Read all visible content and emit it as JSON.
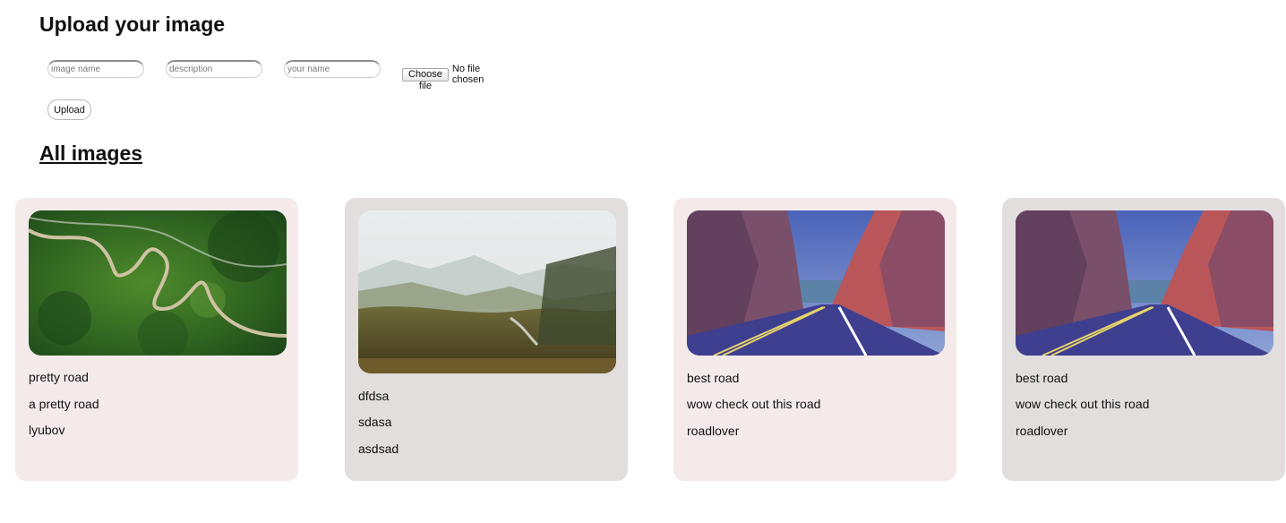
{
  "upload_section": {
    "title": "Upload your image",
    "name_placeholder": "image name",
    "description_placeholder": "description",
    "username_placeholder": "your name",
    "choose_file_label": "Choose file",
    "file_status": "No file chosen",
    "upload_label": "Upload"
  },
  "gallery": {
    "title": "All images",
    "cards": [
      {
        "title": "pretty road",
        "description": "a pretty road",
        "username": "lyubov",
        "image": "winding-forest-road",
        "bg": "#f4eaea"
      },
      {
        "title": "dfdsa",
        "description": "sdasa",
        "username": "asdsad",
        "image": "misty-valley",
        "bg": "#e2dede"
      },
      {
        "title": "best road",
        "description": "wow check out this road",
        "username": "roadlover",
        "image": "canyon-road",
        "bg": "#f4eaea"
      },
      {
        "title": "best road",
        "description": "wow check out this road",
        "username": "roadlover",
        "image": "canyon-road",
        "bg": "#e2dede"
      }
    ]
  }
}
